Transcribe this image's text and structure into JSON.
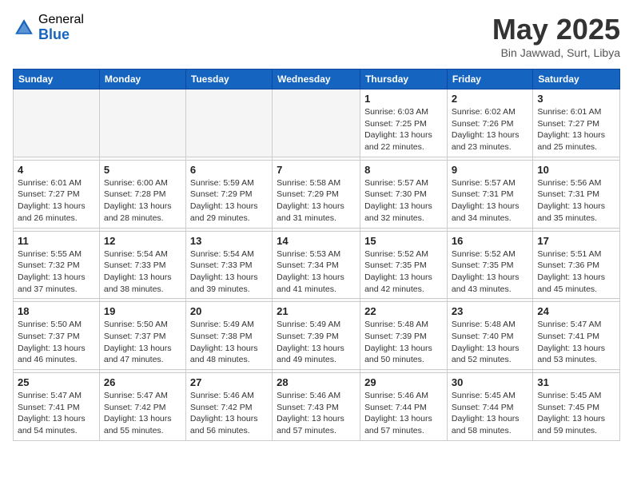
{
  "header": {
    "logo_general": "General",
    "logo_blue": "Blue",
    "month_title": "May 2025",
    "location": "Bin Jawwad, Surt, Libya"
  },
  "days_of_week": [
    "Sunday",
    "Monday",
    "Tuesday",
    "Wednesday",
    "Thursday",
    "Friday",
    "Saturday"
  ],
  "weeks": [
    [
      {
        "day": "",
        "info": ""
      },
      {
        "day": "",
        "info": ""
      },
      {
        "day": "",
        "info": ""
      },
      {
        "day": "",
        "info": ""
      },
      {
        "day": "1",
        "info": "Sunrise: 6:03 AM\nSunset: 7:25 PM\nDaylight: 13 hours\nand 22 minutes."
      },
      {
        "day": "2",
        "info": "Sunrise: 6:02 AM\nSunset: 7:26 PM\nDaylight: 13 hours\nand 23 minutes."
      },
      {
        "day": "3",
        "info": "Sunrise: 6:01 AM\nSunset: 7:27 PM\nDaylight: 13 hours\nand 25 minutes."
      }
    ],
    [
      {
        "day": "4",
        "info": "Sunrise: 6:01 AM\nSunset: 7:27 PM\nDaylight: 13 hours\nand 26 minutes."
      },
      {
        "day": "5",
        "info": "Sunrise: 6:00 AM\nSunset: 7:28 PM\nDaylight: 13 hours\nand 28 minutes."
      },
      {
        "day": "6",
        "info": "Sunrise: 5:59 AM\nSunset: 7:29 PM\nDaylight: 13 hours\nand 29 minutes."
      },
      {
        "day": "7",
        "info": "Sunrise: 5:58 AM\nSunset: 7:29 PM\nDaylight: 13 hours\nand 31 minutes."
      },
      {
        "day": "8",
        "info": "Sunrise: 5:57 AM\nSunset: 7:30 PM\nDaylight: 13 hours\nand 32 minutes."
      },
      {
        "day": "9",
        "info": "Sunrise: 5:57 AM\nSunset: 7:31 PM\nDaylight: 13 hours\nand 34 minutes."
      },
      {
        "day": "10",
        "info": "Sunrise: 5:56 AM\nSunset: 7:31 PM\nDaylight: 13 hours\nand 35 minutes."
      }
    ],
    [
      {
        "day": "11",
        "info": "Sunrise: 5:55 AM\nSunset: 7:32 PM\nDaylight: 13 hours\nand 37 minutes."
      },
      {
        "day": "12",
        "info": "Sunrise: 5:54 AM\nSunset: 7:33 PM\nDaylight: 13 hours\nand 38 minutes."
      },
      {
        "day": "13",
        "info": "Sunrise: 5:54 AM\nSunset: 7:33 PM\nDaylight: 13 hours\nand 39 minutes."
      },
      {
        "day": "14",
        "info": "Sunrise: 5:53 AM\nSunset: 7:34 PM\nDaylight: 13 hours\nand 41 minutes."
      },
      {
        "day": "15",
        "info": "Sunrise: 5:52 AM\nSunset: 7:35 PM\nDaylight: 13 hours\nand 42 minutes."
      },
      {
        "day": "16",
        "info": "Sunrise: 5:52 AM\nSunset: 7:35 PM\nDaylight: 13 hours\nand 43 minutes."
      },
      {
        "day": "17",
        "info": "Sunrise: 5:51 AM\nSunset: 7:36 PM\nDaylight: 13 hours\nand 45 minutes."
      }
    ],
    [
      {
        "day": "18",
        "info": "Sunrise: 5:50 AM\nSunset: 7:37 PM\nDaylight: 13 hours\nand 46 minutes."
      },
      {
        "day": "19",
        "info": "Sunrise: 5:50 AM\nSunset: 7:37 PM\nDaylight: 13 hours\nand 47 minutes."
      },
      {
        "day": "20",
        "info": "Sunrise: 5:49 AM\nSunset: 7:38 PM\nDaylight: 13 hours\nand 48 minutes."
      },
      {
        "day": "21",
        "info": "Sunrise: 5:49 AM\nSunset: 7:39 PM\nDaylight: 13 hours\nand 49 minutes."
      },
      {
        "day": "22",
        "info": "Sunrise: 5:48 AM\nSunset: 7:39 PM\nDaylight: 13 hours\nand 50 minutes."
      },
      {
        "day": "23",
        "info": "Sunrise: 5:48 AM\nSunset: 7:40 PM\nDaylight: 13 hours\nand 52 minutes."
      },
      {
        "day": "24",
        "info": "Sunrise: 5:47 AM\nSunset: 7:41 PM\nDaylight: 13 hours\nand 53 minutes."
      }
    ],
    [
      {
        "day": "25",
        "info": "Sunrise: 5:47 AM\nSunset: 7:41 PM\nDaylight: 13 hours\nand 54 minutes."
      },
      {
        "day": "26",
        "info": "Sunrise: 5:47 AM\nSunset: 7:42 PM\nDaylight: 13 hours\nand 55 minutes."
      },
      {
        "day": "27",
        "info": "Sunrise: 5:46 AM\nSunset: 7:42 PM\nDaylight: 13 hours\nand 56 minutes."
      },
      {
        "day": "28",
        "info": "Sunrise: 5:46 AM\nSunset: 7:43 PM\nDaylight: 13 hours\nand 57 minutes."
      },
      {
        "day": "29",
        "info": "Sunrise: 5:46 AM\nSunset: 7:44 PM\nDaylight: 13 hours\nand 57 minutes."
      },
      {
        "day": "30",
        "info": "Sunrise: 5:45 AM\nSunset: 7:44 PM\nDaylight: 13 hours\nand 58 minutes."
      },
      {
        "day": "31",
        "info": "Sunrise: 5:45 AM\nSunset: 7:45 PM\nDaylight: 13 hours\nand 59 minutes."
      }
    ]
  ]
}
